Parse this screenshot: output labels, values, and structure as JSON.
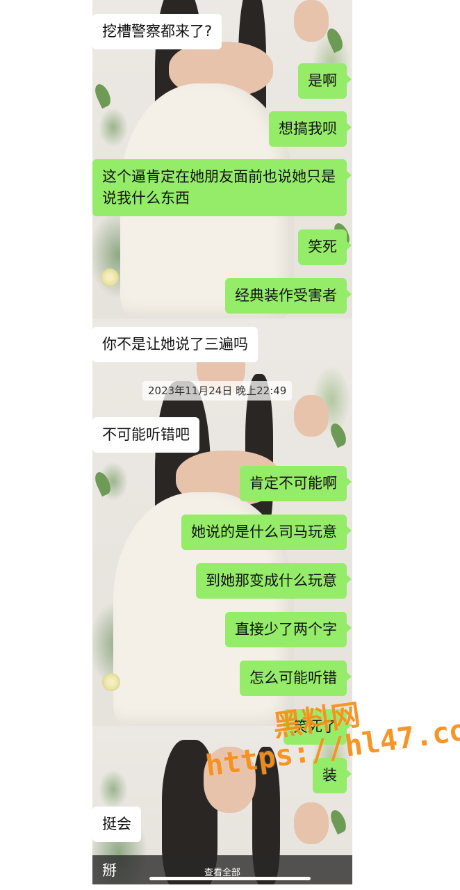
{
  "messages": [
    {
      "text": "挖槽警察都来了?",
      "side": "in"
    },
    {
      "text": "是啊",
      "side": "out"
    },
    {
      "text": "想搞我呗",
      "side": "out"
    },
    {
      "text": "这个逼肯定在她朋友面前也说她只是说我什么东西",
      "side": "out"
    },
    {
      "text": "笑死",
      "side": "out"
    },
    {
      "text": "经典装作受害者",
      "side": "out"
    },
    {
      "text": "你不是让她说了三遍吗",
      "side": "in"
    },
    {
      "text": "不可能听错吧",
      "side": "in"
    },
    {
      "text": "肯定不可能啊",
      "side": "out"
    },
    {
      "text": "她说的是什么司马玩意",
      "side": "out"
    },
    {
      "text": "到她那变成什么玩意",
      "side": "out"
    },
    {
      "text": "直接少了两个字",
      "side": "out"
    },
    {
      "text": "怎么可能听错",
      "side": "out"
    },
    {
      "text": "笑死了",
      "side": "out"
    },
    {
      "text": "装",
      "side": "out"
    },
    {
      "text": "挺会",
      "side": "in"
    }
  ],
  "timestamp": "2023年11月24日 晚上22:49",
  "bottom_bar": {
    "view_all_label": "查看全部",
    "peek_text": "掰"
  },
  "watermark": {
    "name": "黑料网",
    "url": "https://hl47.co",
    "color": "#f68c14"
  },
  "colors": {
    "outgoing_bubble": "#95ec69",
    "incoming_bubble": "#ffffff"
  }
}
